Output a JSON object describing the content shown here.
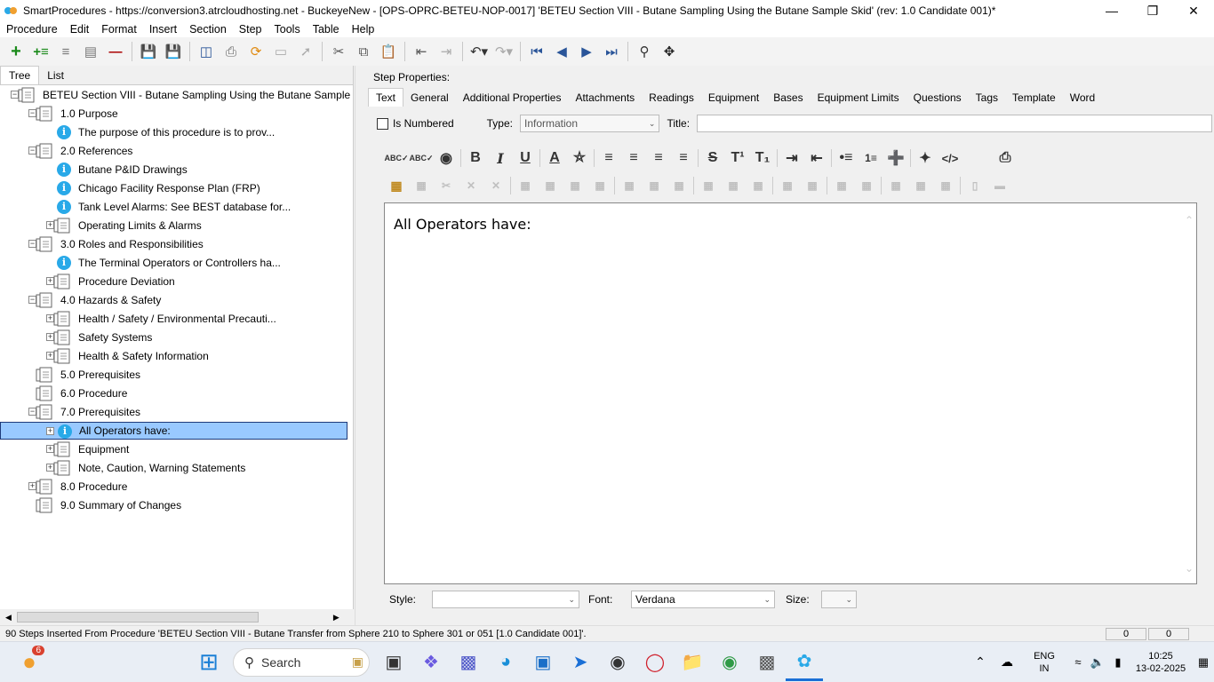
{
  "window": {
    "title": "SmartProcedures - https://conversion3.atrcloudhosting.net - BuckeyeNew - [OPS-OPRC-BETEU-NOP-0017] 'BETEU Section VIII - Butane Sampling Using the Butane Sample Skid' (rev: 1.0 Candidate 001)*"
  },
  "menu": [
    "Procedure",
    "Edit",
    "Format",
    "Insert",
    "Section",
    "Step",
    "Tools",
    "Table",
    "Help"
  ],
  "left_tabs": [
    "Tree",
    "List"
  ],
  "tree": [
    {
      "label": "BETEU Section VIII - Butane Sampling Using the Butane Sample S...",
      "level": 0,
      "icon": "doc",
      "exp": "-"
    },
    {
      "label": "1.0 Purpose",
      "level": 1,
      "icon": "doc",
      "exp": "-"
    },
    {
      "label": "The purpose of this procedure is to prov...",
      "level": 2,
      "icon": "info",
      "exp": ""
    },
    {
      "label": "2.0 References",
      "level": 1,
      "icon": "doc",
      "exp": "-"
    },
    {
      "label": "Butane P&ID Drawings",
      "level": 2,
      "icon": "info",
      "exp": ""
    },
    {
      "label": "Chicago Facility Response Plan (FRP)",
      "level": 2,
      "icon": "info",
      "exp": ""
    },
    {
      "label": "Tank Level Alarms: See BEST database for...",
      "level": 2,
      "icon": "info",
      "exp": ""
    },
    {
      "label": "Operating Limits & Alarms",
      "level": 2,
      "icon": "doc",
      "exp": "+"
    },
    {
      "label": "3.0 Roles and Responsibilities",
      "level": 1,
      "icon": "doc",
      "exp": "-"
    },
    {
      "label": "The Terminal Operators or Controllers ha...",
      "level": 2,
      "icon": "info",
      "exp": ""
    },
    {
      "label": "Procedure Deviation",
      "level": 2,
      "icon": "doc",
      "exp": "+"
    },
    {
      "label": "4.0 Hazards & Safety",
      "level": 1,
      "icon": "doc",
      "exp": "-"
    },
    {
      "label": "Health / Safety / Environmental Precauti...",
      "level": 2,
      "icon": "doc",
      "exp": "+"
    },
    {
      "label": "Safety Systems",
      "level": 2,
      "icon": "doc",
      "exp": "+"
    },
    {
      "label": "Health & Safety Information",
      "level": 2,
      "icon": "doc",
      "exp": "+"
    },
    {
      "label": "5.0 Prerequisites",
      "level": 1,
      "icon": "doc",
      "exp": ""
    },
    {
      "label": "6.0 Procedure",
      "level": 1,
      "icon": "doc",
      "exp": ""
    },
    {
      "label": "7.0 Prerequisites",
      "level": 1,
      "icon": "doc",
      "exp": "-"
    },
    {
      "label": "All Operators have:",
      "level": 2,
      "icon": "info",
      "exp": "+",
      "selected": true
    },
    {
      "label": "Equipment",
      "level": 2,
      "icon": "doc",
      "exp": "+"
    },
    {
      "label": "Note, Caution, Warning Statements",
      "level": 2,
      "icon": "doc",
      "exp": "+"
    },
    {
      "label": "8.0 Procedure",
      "level": 1,
      "icon": "doc",
      "exp": "+"
    },
    {
      "label": "9.0 Summary of Changes",
      "level": 1,
      "icon": "doc",
      "exp": ""
    }
  ],
  "step_props": {
    "heading": "Step Properties:",
    "tabs": [
      "Text",
      "General",
      "Additional Properties",
      "Attachments",
      "Readings",
      "Equipment",
      "Bases",
      "Equipment Limits",
      "Questions",
      "Tags",
      "Template",
      "Word"
    ],
    "is_numbered_label": "Is Numbered",
    "type_label": "Type:",
    "type_value": "Information",
    "title_label": "Title:",
    "title_value": "",
    "editor_text": "All Operators have:",
    "style_label": "Style:",
    "style_value": "",
    "font_label": "Font:",
    "font_value": "Verdana",
    "size_label": "Size:",
    "size_value": ""
  },
  "status_text": "90 Steps Inserted From Procedure 'BETEU Section VIII - Butane Transfer from Sphere 210 to Sphere 301 or 051 [1.0 Candidate 001]'.",
  "status_cells": [
    "0",
    "0"
  ],
  "taskbar": {
    "search_label": "Search",
    "weather_badge": "6",
    "lang1": "ENG",
    "lang2": "IN",
    "time": "10:25",
    "date": "13-02-2025"
  }
}
